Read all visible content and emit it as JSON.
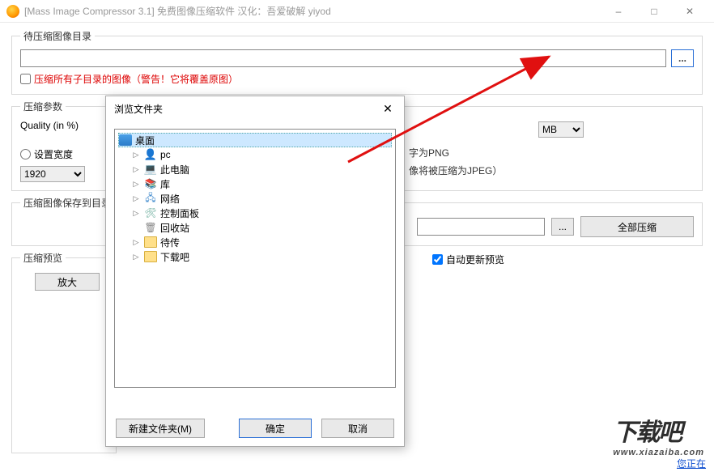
{
  "window": {
    "title": "[Mass Image Compressor 3.1] 免费图像压缩软件 汉化：吾爱破解 yiyod"
  },
  "dir_group": {
    "legend": "待压缩图像目录",
    "path": "",
    "browse": "...",
    "checkbox_label": "压缩所有子目录的图像（警告！它将覆盖原图）"
  },
  "params_group": {
    "legend": "压缩参数",
    "quality_label": "Quality (in %)",
    "set_width_label": "设置宽度",
    "width_value": "1920",
    "unit_value": "MB",
    "png_note": "字为PNG",
    "jpeg_note": "像将被压缩为JPEG）"
  },
  "save_group": {
    "legend": "压缩图像保存到目录",
    "path": "",
    "browse": "...",
    "compress_all": "全部压缩"
  },
  "preview_group": {
    "legend": "压缩预览",
    "zoom": "放大",
    "auto_update": "自动更新预览"
  },
  "dialog": {
    "title": "浏览文件夹",
    "tree": {
      "root": "桌面",
      "items": [
        "pc",
        "此电脑",
        "库",
        "网络",
        "控制面板",
        "回收站",
        "待传",
        "下载吧"
      ]
    },
    "new_folder": "新建文件夹(M)",
    "ok": "确定",
    "cancel": "取消"
  },
  "footer": {
    "watermark_text": "下载吧",
    "watermark_url": "www.xiazaiba.com",
    "status_link": "您正在"
  }
}
